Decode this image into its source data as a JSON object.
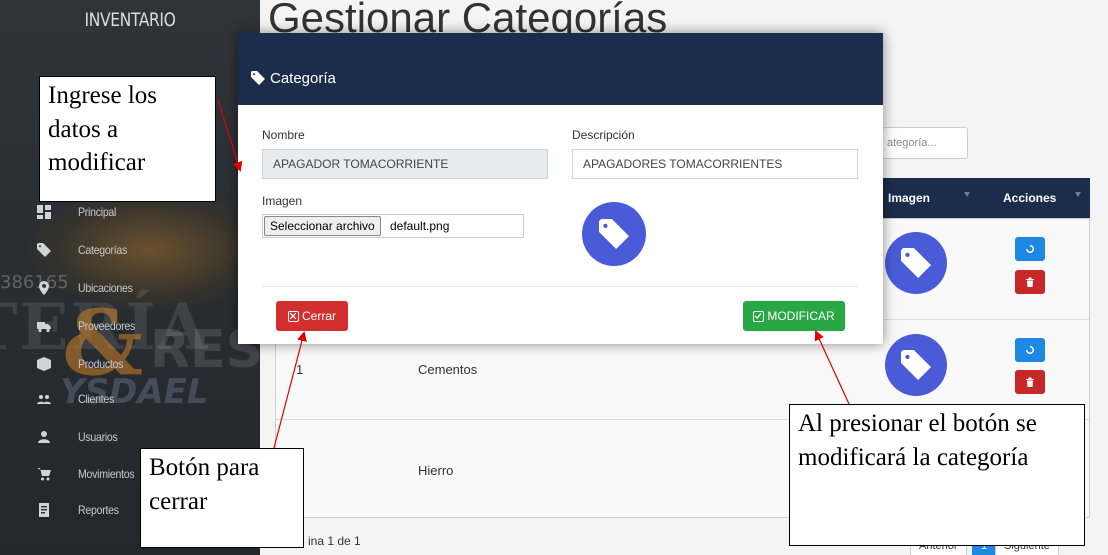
{
  "sidebar": {
    "brand": "INVENTARIO",
    "items": [
      {
        "label": "Principal",
        "icon": "dashboard-icon"
      },
      {
        "label": "Categorías",
        "icon": "tag-icon"
      },
      {
        "label": "Ubicaciones",
        "icon": "location-icon"
      },
      {
        "label": "Proveedores",
        "icon": "truck-icon"
      },
      {
        "label": "Productos",
        "icon": "box-icon"
      },
      {
        "label": "Clientes",
        "icon": "users-icon"
      },
      {
        "label": "Usuarios",
        "icon": "user-icon"
      },
      {
        "label": "Movimientos",
        "icon": "cart-icon"
      },
      {
        "label": "Reportes",
        "icon": "report-icon"
      }
    ],
    "watermark": {
      "number": "386165",
      "left": "TERÍA",
      "amp": "&",
      "right": "RES",
      "brand2": "YSDAEL"
    }
  },
  "main": {
    "title": "Gestionar Categorías",
    "search_placeholder": "ategoría...",
    "table": {
      "headers": [
        "Imagen",
        "Acciones"
      ],
      "rows": [
        {
          "id": "",
          "name": ""
        },
        {
          "id": "1",
          "name": "Cementos"
        },
        {
          "id": "",
          "name": "Hierro"
        }
      ]
    },
    "pager": {
      "text": "ina 1 de 1",
      "prev": "Anterior",
      "current": "1",
      "next": "Siguiente"
    }
  },
  "modal": {
    "title": "Categoría",
    "nombre_label": "Nombre",
    "nombre_value": "APAGADOR TOMACORRIENTE",
    "descripcion_label": "Descripción",
    "descripcion_value": "APAGADORES TOMACORRIENTES",
    "imagen_label": "Imagen",
    "file_button": "Seleccionar archivo",
    "file_name": "default.png",
    "close_label": "Cerrar",
    "modify_label": "MODIFICAR"
  },
  "annotations": {
    "top_left": "Ingrese los datos a modificar",
    "bottom_left": "Botón para cerrar",
    "bottom_right": "Al presionar el botón se modificará la categoría"
  },
  "colors": {
    "header_bg": "#1b2d4a",
    "close_btn": "#d32f2f",
    "modify_btn": "#28a745",
    "tag_circle": "#4a5bd8",
    "arrow": "#e00000"
  }
}
